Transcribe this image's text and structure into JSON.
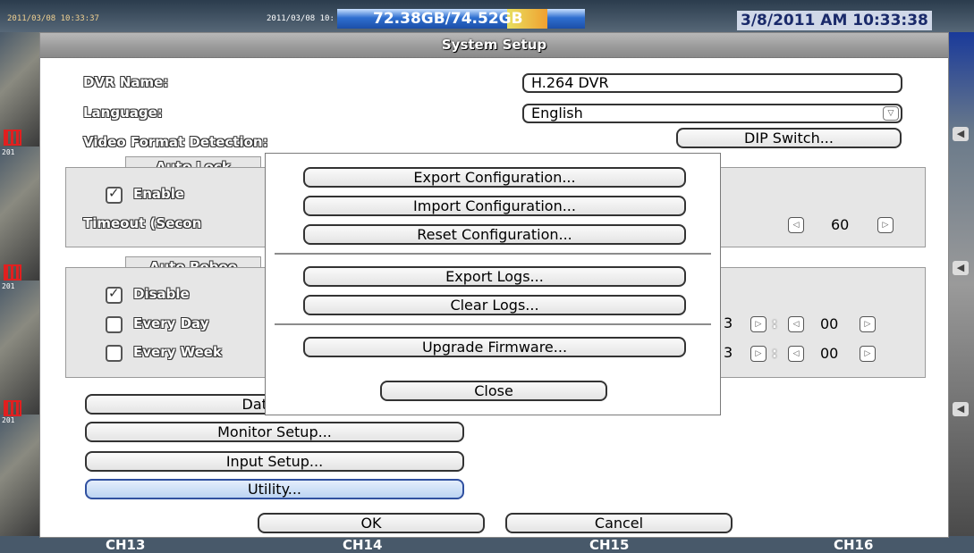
{
  "status_bar": {
    "timestamp_left": "2011/03/08 10:33:37",
    "timestamp_center": "2011/03/08 10:",
    "hdd_usage": "72.38GB/74.52GB",
    "clock": "3/8/2011 AM 10:33:38"
  },
  "channels": [
    "CH13",
    "CH14",
    "CH15",
    "CH16"
  ],
  "camera_timestamps": [
    "201",
    "201",
    "201"
  ],
  "dialog": {
    "title": "System Setup",
    "dvr_name_label": "DVR Name:",
    "dvr_name_value": "H.264 DVR",
    "language_label": "Language:",
    "language_value": "English",
    "video_format_label": "Video Format Detection:",
    "dip_switch_button": "DIP Switch...",
    "auto_lock": {
      "tab": "Auto Lock",
      "enable_label": "Enable",
      "enable_checked": true,
      "timeout_label": "Timeout (Secon",
      "timeout_value": "60"
    },
    "auto_reboot": {
      "tab": "Auto Reboo",
      "options": [
        {
          "label": "Disable",
          "checked": true
        },
        {
          "label": "Every Day",
          "checked": false
        },
        {
          "label": "Every Week",
          "checked": false
        }
      ],
      "every_day_hour": "3",
      "every_day_minute": "00",
      "every_week_hour": "3",
      "every_week_minute": "00"
    },
    "buttons": {
      "date_time": "Date/Tim",
      "monitor_setup": "Monitor Setup...",
      "input_setup": "Input Setup...",
      "utility": "Utility...",
      "ok": "OK",
      "cancel": "Cancel"
    }
  },
  "utility_popup": {
    "export_config": "Export Configuration...",
    "import_config": "Import Configuration...",
    "reset_config": "Reset Configuration...",
    "export_logs": "Export Logs...",
    "clear_logs": "Clear Logs...",
    "upgrade_firmware": "Upgrade Firmware...",
    "close": "Close"
  },
  "colors": {
    "dialog_bg": "#ffffff",
    "group_bg": "#e6e6e6",
    "selected_button": "#bcd4f2",
    "title_bar": "#999999"
  }
}
